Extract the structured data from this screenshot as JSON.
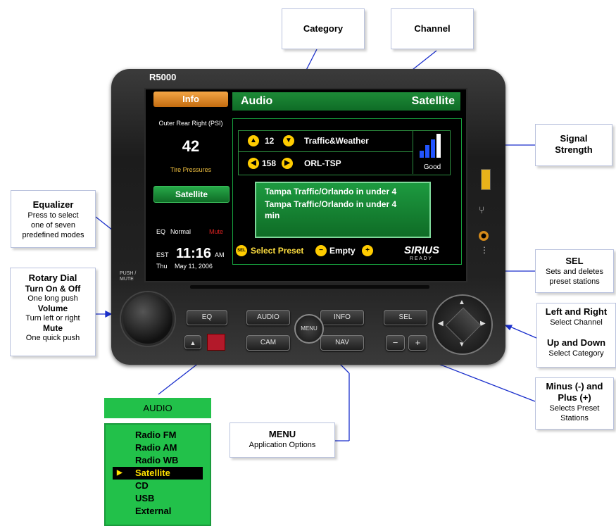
{
  "device": {
    "model": "R5000",
    "push_mute": "PUSH / MUTE",
    "info_tab": "Info",
    "outer_rear": "Outer Rear Right (PSI)",
    "psi_value": "42",
    "tire_pressures": "Tire Pressures",
    "satellite_tab": "Satellite",
    "eq_label": "EQ",
    "eq_value": "Normal",
    "mute": "Mute",
    "tz": "EST",
    "time": "11:16",
    "ampm": "AM",
    "day": "Thu",
    "date": "May 11, 2006",
    "header_left": "Audio",
    "header_right": "Satellite",
    "channel_row1_num": "12",
    "channel_row1_name": "Traffic&Weather",
    "channel_row2_num": "158",
    "channel_row2_name": "ORL-TSP",
    "signal_label": "Good",
    "signal_level": 0.8,
    "song_line1": "Tampa Traffic/Orlando in under 4",
    "song_line2": "Tampa Traffic/Orlando in under 4",
    "song_line3": "min",
    "sel_icon": "SEL",
    "select_preset": "Select Preset",
    "empty": "Empty",
    "sirius": "SIRIUS",
    "sirius_sub": "R E A D Y",
    "buttons": {
      "eq": "EQ",
      "audio": "AUDIO",
      "info": "INFO",
      "sel": "SEL",
      "menu": "MENU",
      "cam": "CAM",
      "nav": "NAV",
      "minus": "−",
      "plus": "+"
    }
  },
  "callouts": {
    "category": "Category",
    "channel": "Channel",
    "signal_title": "Signal",
    "signal_title2": "Strength",
    "equalizer_title": "Equalizer",
    "equalizer_desc1": "Press to select",
    "equalizer_desc2": "one of seven",
    "equalizer_desc3": "predefined modes",
    "rotary_title": "Rotary Dial",
    "rotary_on": "Turn On & Off",
    "rotary_on_desc": "One long push",
    "rotary_vol": "Volume",
    "rotary_vol_desc": "Turn left or right",
    "rotary_mute": "Mute",
    "rotary_mute_desc": "One quick push",
    "sel_title": "SEL",
    "sel_desc1": "Sets and deletes",
    "sel_desc2": "preset stations",
    "lr_title": "Left and Right",
    "lr_desc": "Select Channel",
    "ud_title": "Up and Down",
    "ud_desc": "Select Category",
    "mp_title1": "Minus (-) and",
    "mp_title2": "Plus (+)",
    "mp_desc1": "Selects Preset",
    "mp_desc2": "Stations",
    "menu_title": "MENU",
    "menu_desc": "Application Options"
  },
  "audio_menu": {
    "title": "AUDIO",
    "items": [
      "Radio FM",
      "Radio AM",
      "Radio WB",
      "Satellite",
      "CD",
      "USB",
      "External"
    ],
    "selected": "Satellite"
  },
  "colors": {
    "green": "#22a94a",
    "orange": "#e58a1c",
    "yellow": "#ffcc00",
    "callout_line": "#1a2fcc"
  }
}
